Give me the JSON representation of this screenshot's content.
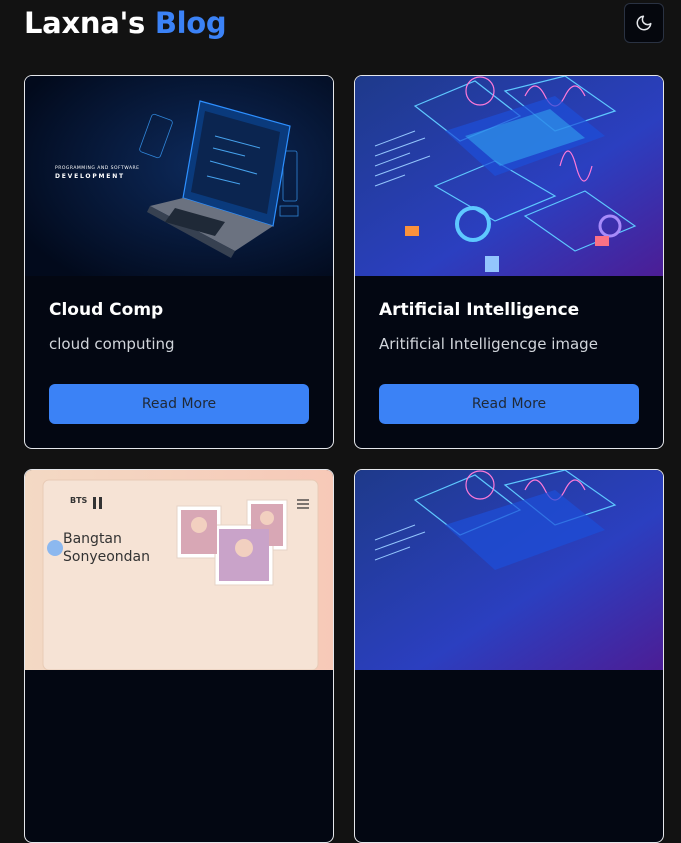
{
  "header": {
    "brand_prefix": "Laxna's",
    "brand_accent": "Blog",
    "theme_icon": "moon-icon"
  },
  "colors": {
    "background": "#121212",
    "accent": "#3b82f6",
    "card_background": "#030712",
    "card_border": "#e5e7eb"
  },
  "posts": [
    {
      "title": "Cloud Comp",
      "description": "cloud computing",
      "button_label": "Read More",
      "image_caption_line1": "PROGRAMMING AND SOFTWARE",
      "image_caption_line2": "DEVELOPMENT"
    },
    {
      "title": "Artificial Intelligence",
      "description": "Aritificial Intelligencge image",
      "button_label": "Read More"
    },
    {
      "image_logo": "BTS",
      "image_text_line1": "Bangtan",
      "image_text_line2": "Sonyeondan"
    },
    {}
  ]
}
